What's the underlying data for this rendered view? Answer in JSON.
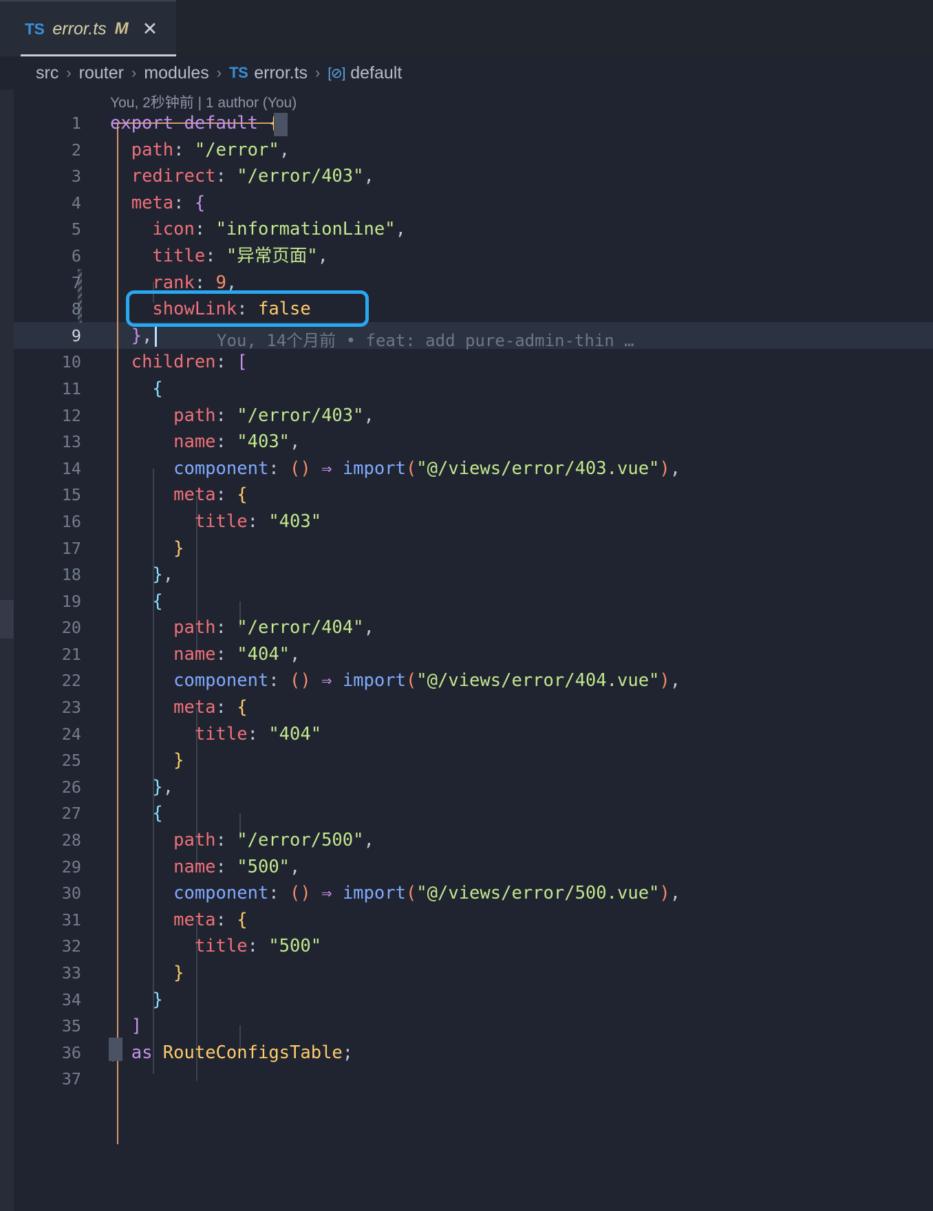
{
  "window": {
    "background": "#1f2430",
    "accent_highlight": "#29a8f2"
  },
  "tab": {
    "file_icon": "typescript-icon",
    "file_icon_label": "TS",
    "title": "error.ts",
    "dirty_marker": "M",
    "close_label": "✕"
  },
  "breadcrumb": {
    "items": [
      "src",
      "router",
      "modules",
      "error.ts",
      "default"
    ],
    "separator": "›",
    "ts_icon_label": "TS",
    "symbol_icon_label": "[⊘]"
  },
  "blame": {
    "top": "You, 2秒钟前 | 1 author (You)",
    "inline_line9": "You, 14个月前 • feat: add pure-admin-thin …"
  },
  "highlight": {
    "target_text": "showLink: false",
    "color": "#29a8f2"
  },
  "code": {
    "language": "typescript",
    "lines": [
      {
        "n": "1",
        "indent": 0,
        "tokens": [
          {
            "t": "export default ",
            "c": "kw"
          },
          {
            "t": "{",
            "c": "br1"
          }
        ]
      },
      {
        "n": "2",
        "indent": 1,
        "tokens": [
          {
            "t": "path",
            "c": "prop"
          },
          {
            "t": ": ",
            "c": "white"
          },
          {
            "t": "\"/error\"",
            "c": "str"
          },
          {
            "t": ",",
            "c": "white"
          }
        ]
      },
      {
        "n": "3",
        "indent": 1,
        "tokens": [
          {
            "t": "redirect",
            "c": "prop"
          },
          {
            "t": ": ",
            "c": "white"
          },
          {
            "t": "\"/error/403\"",
            "c": "str"
          },
          {
            "t": ",",
            "c": "white"
          }
        ]
      },
      {
        "n": "4",
        "indent": 1,
        "tokens": [
          {
            "t": "meta",
            "c": "prop"
          },
          {
            "t": ": ",
            "c": "white"
          },
          {
            "t": "{",
            "c": "br2"
          }
        ]
      },
      {
        "n": "5",
        "indent": 2,
        "tokens": [
          {
            "t": "icon",
            "c": "prop"
          },
          {
            "t": ": ",
            "c": "white"
          },
          {
            "t": "\"informationLine\"",
            "c": "str"
          },
          {
            "t": ",",
            "c": "white"
          }
        ]
      },
      {
        "n": "6",
        "indent": 2,
        "tokens": [
          {
            "t": "title",
            "c": "prop"
          },
          {
            "t": ": ",
            "c": "white"
          },
          {
            "t": "\"异常页面\"",
            "c": "str"
          },
          {
            "t": ",",
            "c": "white"
          }
        ]
      },
      {
        "n": "7",
        "indent": 2,
        "tokens": [
          {
            "t": "rank",
            "c": "prop"
          },
          {
            "t": ": ",
            "c": "white"
          },
          {
            "t": "9",
            "c": "num"
          },
          {
            "t": ",",
            "c": "white"
          }
        ]
      },
      {
        "n": "8",
        "indent": 2,
        "tokens": [
          {
            "t": "showLink",
            "c": "prop"
          },
          {
            "t": ": ",
            "c": "white"
          },
          {
            "t": "false",
            "c": "bool"
          }
        ]
      },
      {
        "n": "9",
        "indent": 1,
        "tokens": [
          {
            "t": "}",
            "c": "br2"
          },
          {
            "t": ",",
            "c": "white"
          }
        ]
      },
      {
        "n": "10",
        "indent": 1,
        "tokens": [
          {
            "t": "children",
            "c": "prop"
          },
          {
            "t": ": ",
            "c": "white"
          },
          {
            "t": "[",
            "c": "br2"
          }
        ]
      },
      {
        "n": "11",
        "indent": 2,
        "tokens": [
          {
            "t": "{",
            "c": "br3"
          }
        ]
      },
      {
        "n": "12",
        "indent": 3,
        "tokens": [
          {
            "t": "path",
            "c": "prop"
          },
          {
            "t": ": ",
            "c": "white"
          },
          {
            "t": "\"/error/403\"",
            "c": "str"
          },
          {
            "t": ",",
            "c": "white"
          }
        ]
      },
      {
        "n": "13",
        "indent": 3,
        "tokens": [
          {
            "t": "name",
            "c": "prop"
          },
          {
            "t": ": ",
            "c": "white"
          },
          {
            "t": "\"403\"",
            "c": "str"
          },
          {
            "t": ",",
            "c": "white"
          }
        ]
      },
      {
        "n": "14",
        "indent": 3,
        "tokens": [
          {
            "t": "component",
            "c": "fn"
          },
          {
            "t": ": ",
            "c": "white"
          },
          {
            "t": "()",
            "c": "paren"
          },
          {
            "t": " ",
            "c": "white"
          },
          {
            "t": "⇒",
            "c": "br2"
          },
          {
            "t": " ",
            "c": "white"
          },
          {
            "t": "import",
            "c": "fn"
          },
          {
            "t": "(",
            "c": "paren"
          },
          {
            "t": "\"@/views/error/403.vue\"",
            "c": "str"
          },
          {
            "t": ")",
            "c": "paren"
          },
          {
            "t": ",",
            "c": "white"
          }
        ]
      },
      {
        "n": "15",
        "indent": 3,
        "tokens": [
          {
            "t": "meta",
            "c": "prop"
          },
          {
            "t": ": ",
            "c": "white"
          },
          {
            "t": "{",
            "c": "br1"
          }
        ]
      },
      {
        "n": "16",
        "indent": 4,
        "tokens": [
          {
            "t": "title",
            "c": "prop"
          },
          {
            "t": ": ",
            "c": "white"
          },
          {
            "t": "\"403\"",
            "c": "str"
          }
        ]
      },
      {
        "n": "17",
        "indent": 3,
        "tokens": [
          {
            "t": "}",
            "c": "br1"
          }
        ]
      },
      {
        "n": "18",
        "indent": 2,
        "tokens": [
          {
            "t": "}",
            "c": "br3"
          },
          {
            "t": ",",
            "c": "white"
          }
        ]
      },
      {
        "n": "19",
        "indent": 2,
        "tokens": [
          {
            "t": "{",
            "c": "br3"
          }
        ]
      },
      {
        "n": "20",
        "indent": 3,
        "tokens": [
          {
            "t": "path",
            "c": "prop"
          },
          {
            "t": ": ",
            "c": "white"
          },
          {
            "t": "\"/error/404\"",
            "c": "str"
          },
          {
            "t": ",",
            "c": "white"
          }
        ]
      },
      {
        "n": "21",
        "indent": 3,
        "tokens": [
          {
            "t": "name",
            "c": "prop"
          },
          {
            "t": ": ",
            "c": "white"
          },
          {
            "t": "\"404\"",
            "c": "str"
          },
          {
            "t": ",",
            "c": "white"
          }
        ]
      },
      {
        "n": "22",
        "indent": 3,
        "tokens": [
          {
            "t": "component",
            "c": "fn"
          },
          {
            "t": ": ",
            "c": "white"
          },
          {
            "t": "()",
            "c": "paren"
          },
          {
            "t": " ",
            "c": "white"
          },
          {
            "t": "⇒",
            "c": "br2"
          },
          {
            "t": " ",
            "c": "white"
          },
          {
            "t": "import",
            "c": "fn"
          },
          {
            "t": "(",
            "c": "paren"
          },
          {
            "t": "\"@/views/error/404.vue\"",
            "c": "str"
          },
          {
            "t": ")",
            "c": "paren"
          },
          {
            "t": ",",
            "c": "white"
          }
        ]
      },
      {
        "n": "23",
        "indent": 3,
        "tokens": [
          {
            "t": "meta",
            "c": "prop"
          },
          {
            "t": ": ",
            "c": "white"
          },
          {
            "t": "{",
            "c": "br1"
          }
        ]
      },
      {
        "n": "24",
        "indent": 4,
        "tokens": [
          {
            "t": "title",
            "c": "prop"
          },
          {
            "t": ": ",
            "c": "white"
          },
          {
            "t": "\"404\"",
            "c": "str"
          }
        ]
      },
      {
        "n": "25",
        "indent": 3,
        "tokens": [
          {
            "t": "}",
            "c": "br1"
          }
        ]
      },
      {
        "n": "26",
        "indent": 2,
        "tokens": [
          {
            "t": "}",
            "c": "br3"
          },
          {
            "t": ",",
            "c": "white"
          }
        ]
      },
      {
        "n": "27",
        "indent": 2,
        "tokens": [
          {
            "t": "{",
            "c": "br3"
          }
        ]
      },
      {
        "n": "28",
        "indent": 3,
        "tokens": [
          {
            "t": "path",
            "c": "prop"
          },
          {
            "t": ": ",
            "c": "white"
          },
          {
            "t": "\"/error/500\"",
            "c": "str"
          },
          {
            "t": ",",
            "c": "white"
          }
        ]
      },
      {
        "n": "29",
        "indent": 3,
        "tokens": [
          {
            "t": "name",
            "c": "prop"
          },
          {
            "t": ": ",
            "c": "white"
          },
          {
            "t": "\"500\"",
            "c": "str"
          },
          {
            "t": ",",
            "c": "white"
          }
        ]
      },
      {
        "n": "30",
        "indent": 3,
        "tokens": [
          {
            "t": "component",
            "c": "fn"
          },
          {
            "t": ": ",
            "c": "white"
          },
          {
            "t": "()",
            "c": "paren"
          },
          {
            "t": " ",
            "c": "white"
          },
          {
            "t": "⇒",
            "c": "br2"
          },
          {
            "t": " ",
            "c": "white"
          },
          {
            "t": "import",
            "c": "fn"
          },
          {
            "t": "(",
            "c": "paren"
          },
          {
            "t": "\"@/views/error/500.vue\"",
            "c": "str"
          },
          {
            "t": ")",
            "c": "paren"
          },
          {
            "t": ",",
            "c": "white"
          }
        ]
      },
      {
        "n": "31",
        "indent": 3,
        "tokens": [
          {
            "t": "meta",
            "c": "prop"
          },
          {
            "t": ": ",
            "c": "white"
          },
          {
            "t": "{",
            "c": "br1"
          }
        ]
      },
      {
        "n": "32",
        "indent": 4,
        "tokens": [
          {
            "t": "title",
            "c": "prop"
          },
          {
            "t": ": ",
            "c": "white"
          },
          {
            "t": "\"500\"",
            "c": "str"
          }
        ]
      },
      {
        "n": "33",
        "indent": 3,
        "tokens": [
          {
            "t": "}",
            "c": "br1"
          }
        ]
      },
      {
        "n": "34",
        "indent": 2,
        "tokens": [
          {
            "t": "}",
            "c": "br3"
          }
        ]
      },
      {
        "n": "35",
        "indent": 1,
        "tokens": [
          {
            "t": "]",
            "c": "br2"
          }
        ]
      },
      {
        "n": "36",
        "indent": 0,
        "tokens": [
          {
            "t": "}",
            "c": "br1"
          },
          {
            "t": " ",
            "c": "white"
          },
          {
            "t": "as",
            "c": "kw"
          },
          {
            "t": " ",
            "c": "white"
          },
          {
            "t": "RouteConfigsTable",
            "c": "type"
          },
          {
            "t": ";",
            "c": "white"
          }
        ]
      },
      {
        "n": "37",
        "indent": 0,
        "tokens": []
      }
    ]
  }
}
